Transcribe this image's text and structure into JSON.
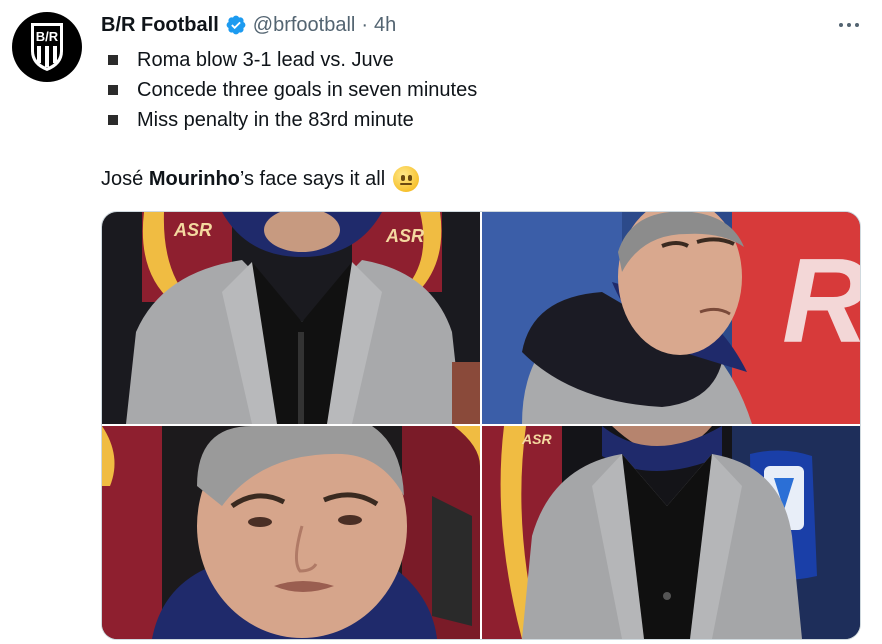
{
  "tweet": {
    "author_name": "B/R Football",
    "handle": "@brfootball",
    "separator": "·",
    "time": "4h",
    "avatar_text": "B/R",
    "bullets": [
      "Roma blow 3-1 lead vs. Juve",
      "Concede three goals in seven minutes",
      "Miss penalty in the 83rd minute"
    ],
    "text_before": "José ",
    "text_bold": "Mourinho",
    "text_after": "’s face says it all",
    "emoji": "neutral-face-emoji",
    "photos": [
      {
        "sign_text": "ASR",
        "sign_text_2": "ASR"
      },
      {
        "sign_text": "R"
      },
      {},
      {
        "sign_text": "ASR"
      }
    ]
  },
  "colors": {
    "accent": "#1d9bf0",
    "text": "#0f1419",
    "secondary": "#536471",
    "border": "#cfd9de",
    "roma_red": "#8e1f2f",
    "roma_yellow": "#f0bc42"
  }
}
